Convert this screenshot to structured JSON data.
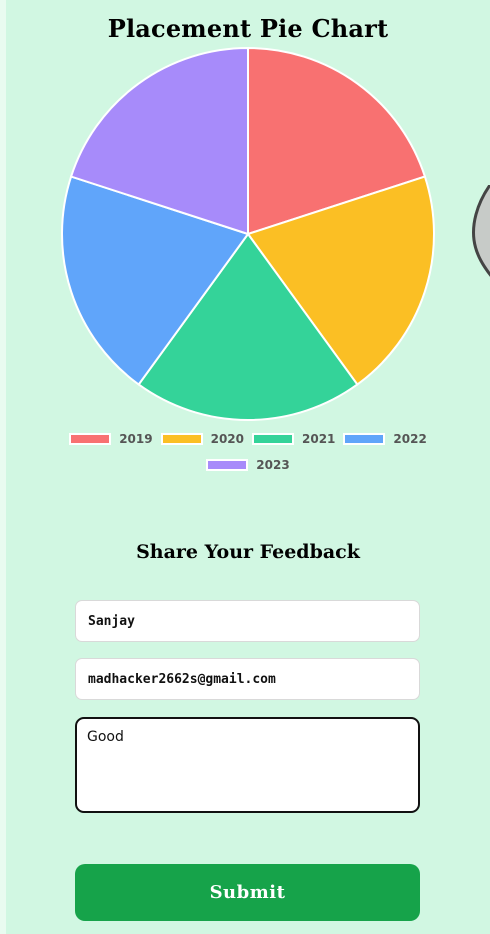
{
  "chart_data": {
    "type": "pie",
    "title": "Placement Pie Chart",
    "categories": [
      "2019",
      "2020",
      "2021",
      "2022",
      "2023"
    ],
    "values": [
      20,
      20,
      20,
      20,
      20
    ],
    "colors": [
      "#f87171",
      "#fbbf24",
      "#34d399",
      "#60a5fa",
      "#a78bfa"
    ],
    "legend_position": "bottom"
  },
  "feedback": {
    "title": "Share Your Feedback",
    "name_value": "Sanjay",
    "email_value": "madhacker2662s@gmail.com",
    "message_value": "Good",
    "submit_label": "Submit"
  }
}
